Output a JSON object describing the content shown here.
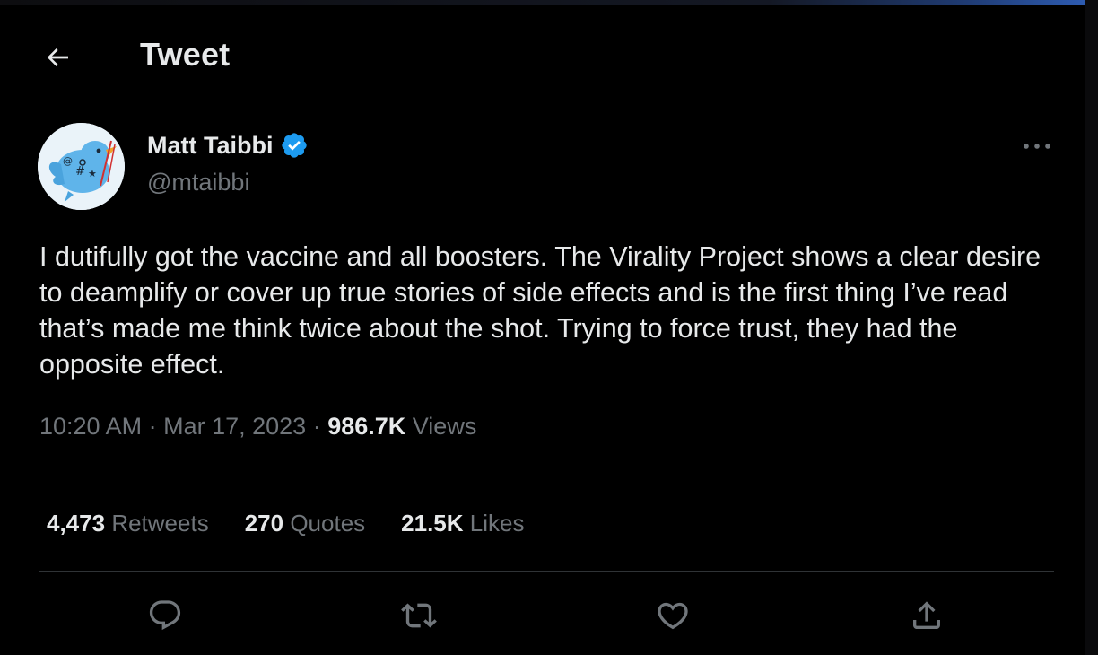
{
  "header": {
    "back_icon": "arrow-left-icon",
    "title": "Tweet"
  },
  "author": {
    "name": "Matt Taibbi",
    "handle": "@mtaibbi",
    "verified_icon": "verified-badge-icon",
    "verified_color": "#1d9bf0",
    "more_icon": "more-horizontal-icon"
  },
  "tweet": {
    "text": "I dutifully got the vaccine and all boosters. The Virality Project shows a clear desire to deamplify or cover up true stories of side effects and is the first thing I’ve read that’s made me think twice about the shot. Trying to force trust, they had the opposite effect.",
    "time": "10:20 AM",
    "date": "Mar 17, 2023",
    "separator": " · ",
    "views_count": "986.7K",
    "views_label": "Views"
  },
  "stats": {
    "retweets_count": "4,473",
    "retweets_label": "Retweets",
    "quotes_count": "270",
    "quotes_label": "Quotes",
    "likes_count": "21.5K",
    "likes_label": "Likes"
  },
  "actions": {
    "reply_icon": "reply-icon",
    "retweet_icon": "retweet-icon",
    "like_icon": "heart-icon",
    "share_icon": "share-icon"
  },
  "colors": {
    "background": "#000000",
    "primary_text": "#e7e9ea",
    "secondary_text": "#71767b",
    "divider": "#2f3336",
    "accent": "#1d9bf0"
  }
}
